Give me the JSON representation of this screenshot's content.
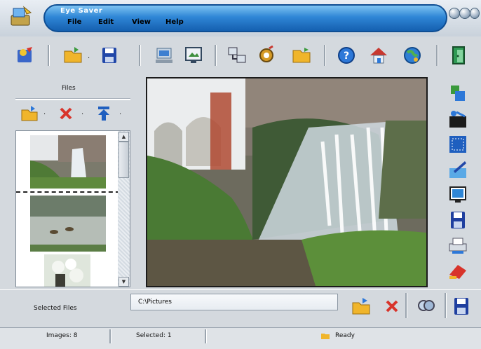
{
  "window": {
    "title": "Eye Saver",
    "menu": [
      "File",
      "Edit",
      "View",
      "Help"
    ]
  },
  "toolbar": {
    "buttons": [
      {
        "name": "wizard-icon",
        "color": "#3a66c9"
      },
      {
        "name": "open-folder-icon",
        "color": "#f0b52b"
      },
      {
        "name": "save-icon",
        "color": "#2147a8"
      },
      {
        "name": "computer-icon",
        "color": "#4f6f8f"
      },
      {
        "name": "monitor-icon",
        "color": "#5b7fa6"
      },
      {
        "name": "network-icon",
        "color": "#6c7f98"
      },
      {
        "name": "settings-icon",
        "color": "#d59a25"
      },
      {
        "name": "folder-icon",
        "color": "#f0b52b"
      },
      {
        "name": "help-icon",
        "color": "#2d78d8"
      },
      {
        "name": "home-icon",
        "color": "#c8382f"
      },
      {
        "name": "globe-icon",
        "color": "#2f7fd4"
      },
      {
        "name": "exit-icon",
        "color": "#2f9a54"
      }
    ]
  },
  "left_panel": {
    "label": "Files",
    "tools": [
      {
        "name": "open-folder-icon"
      },
      {
        "name": "delete-icon"
      },
      {
        "name": "move-up-icon"
      }
    ]
  },
  "right_tools": [
    {
      "name": "copy-tool-icon"
    },
    {
      "name": "cut-tool-icon"
    },
    {
      "name": "select-tool-icon"
    },
    {
      "name": "edit-tool-icon"
    },
    {
      "name": "monitor-tool-icon"
    },
    {
      "name": "save-tool-icon"
    },
    {
      "name": "print-tool-icon"
    },
    {
      "name": "erase-tool-icon"
    }
  ],
  "bottom": {
    "folder_label": "Selected Files",
    "path_value": "C:\\Pictures",
    "buttons": [
      {
        "name": "open-folder-icon"
      },
      {
        "name": "delete-icon"
      },
      {
        "name": "search-icon"
      },
      {
        "name": "save-icon"
      }
    ]
  },
  "status": {
    "cell1": "Images: 8",
    "cell2": "Selected: 1",
    "cell3": "Ready"
  },
  "colors": {
    "title_bar": "#2f86d6",
    "accent_red": "#d8342b",
    "accent_blue": "#1f5fbf"
  }
}
